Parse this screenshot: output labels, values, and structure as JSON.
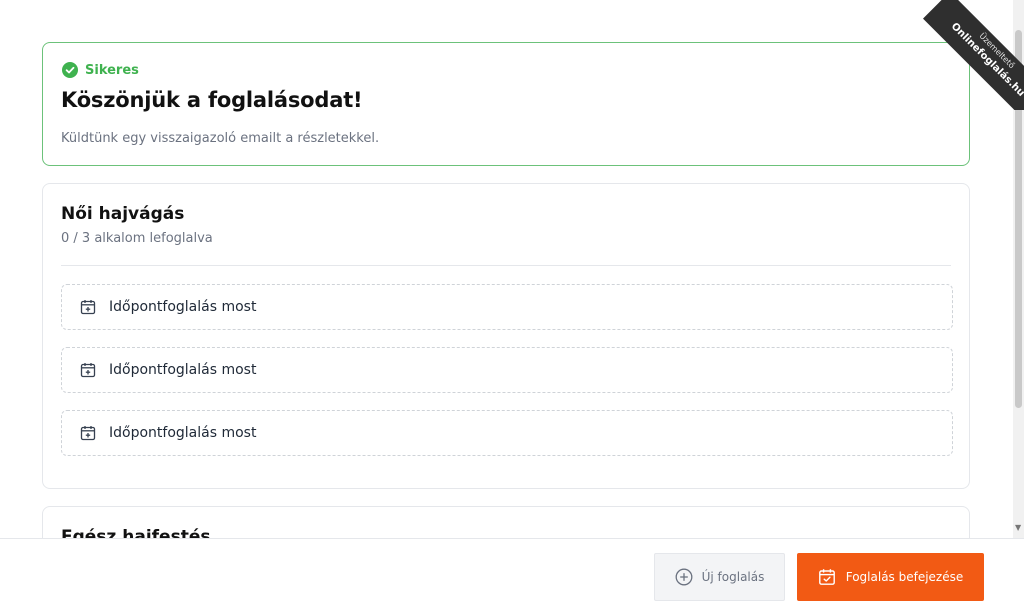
{
  "success": {
    "status": "Sikeres",
    "title": "Köszönjük a foglalásodat!",
    "message": "Küldtünk egy visszaigazoló emailt a részletekkel."
  },
  "services": [
    {
      "title": "Női hajvágás",
      "subtitle": "0 / 3 alkalom lefoglalva",
      "slots": [
        {
          "label": "Időpontfoglalás most"
        },
        {
          "label": "Időpontfoglalás most"
        },
        {
          "label": "Időpontfoglalás most"
        }
      ]
    },
    {
      "title": "Egész hajfestés"
    }
  ],
  "ribbon": {
    "small": "Üzemeltető",
    "big": "Onlinefoglalás.hu"
  },
  "footer": {
    "new_booking": "Új foglalás",
    "finish_booking": "Foglalás befejezése"
  },
  "colors": {
    "accent": "#f25a14",
    "success": "#3fb24f"
  }
}
